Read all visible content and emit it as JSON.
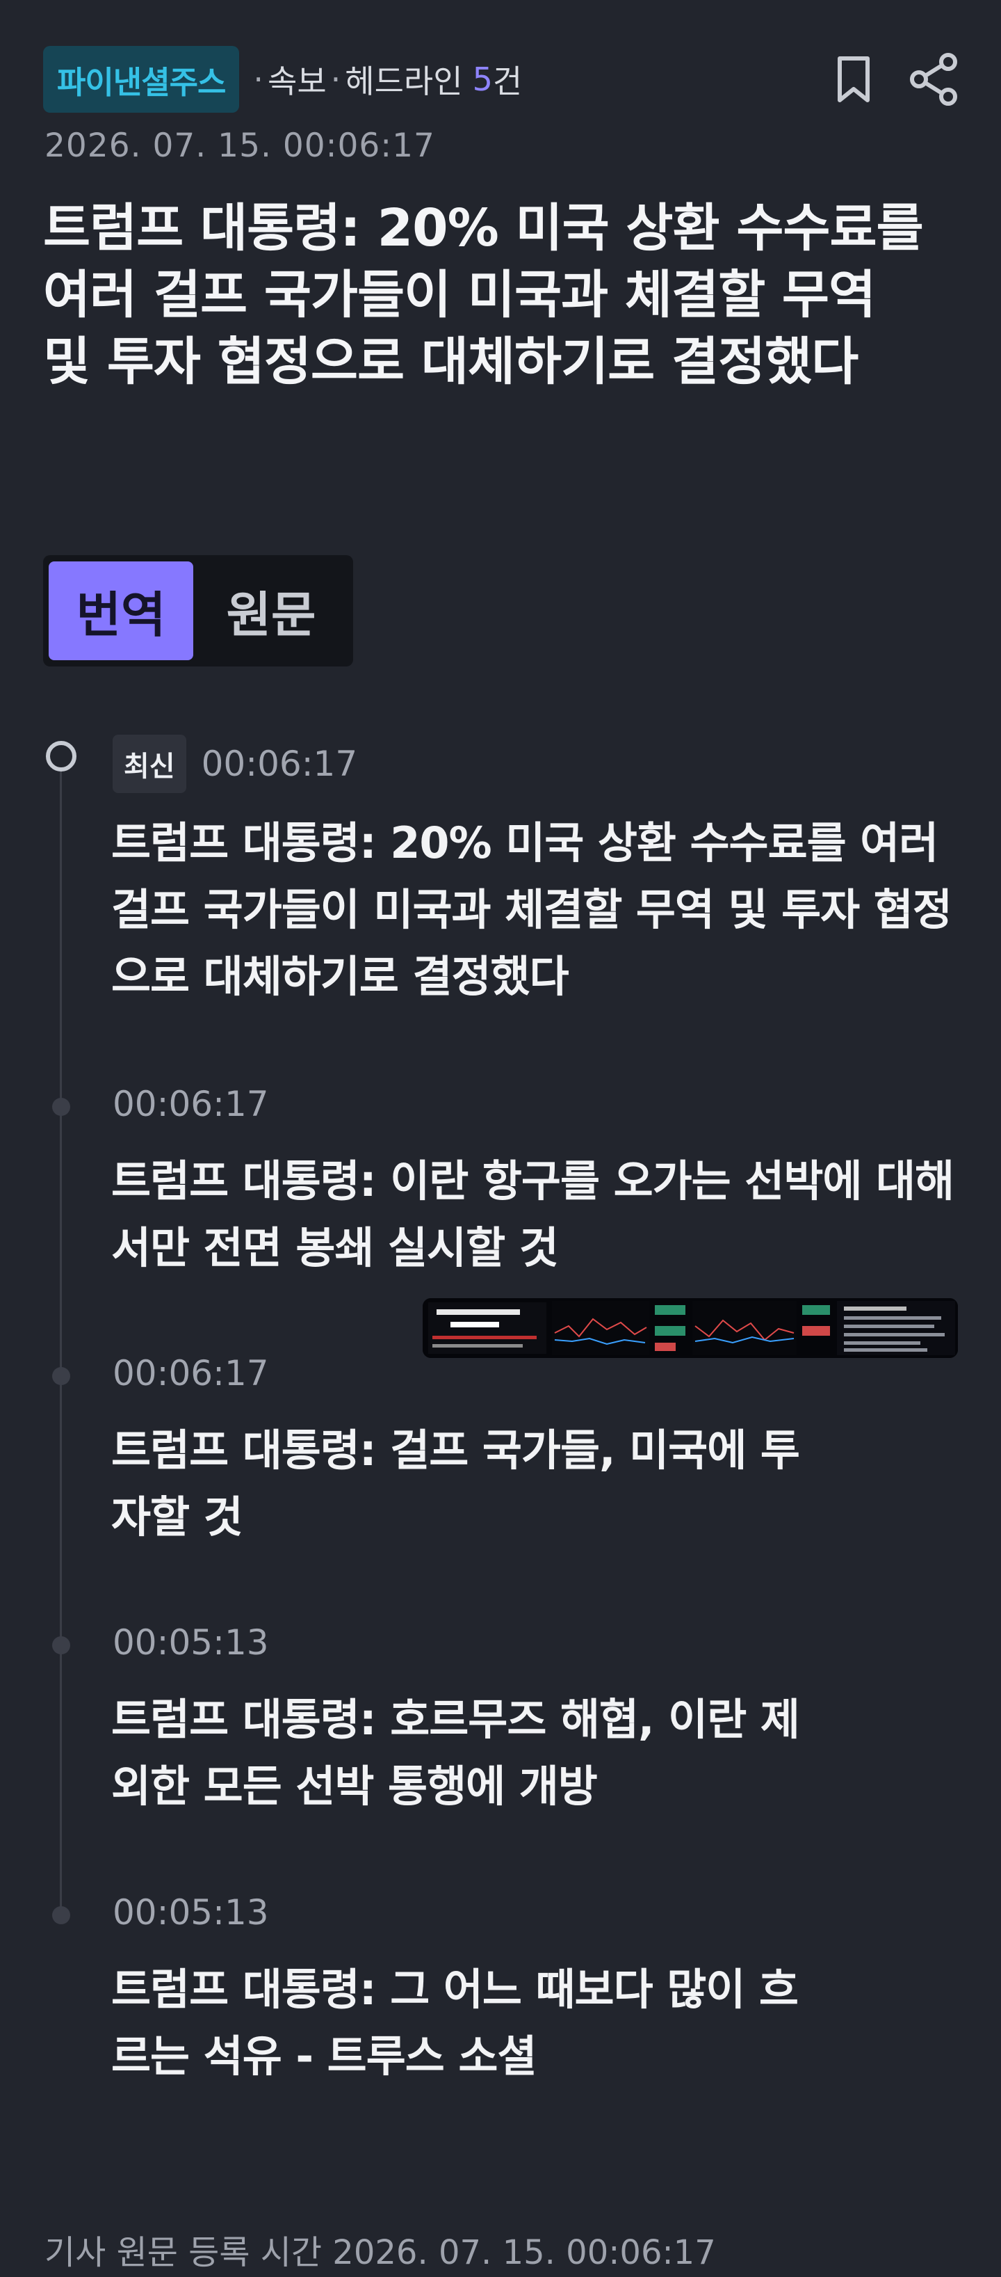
{
  "header": {
    "source": "파이낸셜주스",
    "category": "속보",
    "label": "헤드라인",
    "count": "5",
    "count_suffix": "건",
    "bookmark_icon": "bookmark-icon",
    "share_icon": "share-icon"
  },
  "datetime": "2026. 07. 15. 00:06:17",
  "headline": "트럼프 대통령: 20% 미국 상환 수수료를 여러 걸프 국가들이 미국과 체결할 무역 및 투자 협정으로 대체하기로 결정했다",
  "toggle": {
    "translated": "번역",
    "original": "원문",
    "selected": "번역"
  },
  "timeline": {
    "latest_badge": "최신",
    "items": [
      {
        "time": "00:06:17",
        "text": "트럼프 대통령: 20% 미국 상환 수수료를 여러 걸프 국가들이 미국과 체결할 무역 및 투자 협정으로 대체하기로 결정했다"
      },
      {
        "time": "00:06:17",
        "text": "트럼프 대통령: 이란 항구를 오가는 선박에 대해서만 전면 봉쇄 실시할 것"
      },
      {
        "time": "00:06:17",
        "text": "트럼프 대통령: 걸프 국가들, 미국에 투자할 것"
      },
      {
        "time": "00:05:13",
        "text": "트럼프 대통령: 호르무즈 해협, 이란 제외한 모든 선박 통행에 개방"
      },
      {
        "time": "00:05:13",
        "text": "트럼프 대통령: 그 어느 때보다 많이 흐르는 석유 - 트루스 소셜"
      }
    ]
  },
  "footer": "기사 원문 등록 시간 2026. 07. 15. 00:06:17",
  "colors": {
    "background": "#22252d",
    "accent": "#8678ff",
    "source_badge_bg": "#164555",
    "source_badge_text": "#35c1e6"
  }
}
